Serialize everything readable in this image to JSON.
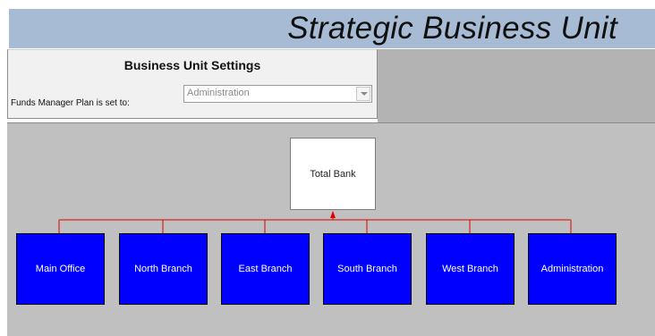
{
  "header": {
    "title": "Strategic Business Unit"
  },
  "settings": {
    "heading": "Business Unit Settings",
    "funds_label": "Funds Manager Plan is set to:",
    "funds_value": "Administration"
  },
  "org_chart": {
    "root": "Total Bank",
    "units": [
      "Main Office",
      "North Branch",
      "East Branch",
      "South Branch",
      "West Branch",
      "Administration"
    ],
    "connector_color": "#e00000",
    "unit_fill": "#0000ff"
  }
}
